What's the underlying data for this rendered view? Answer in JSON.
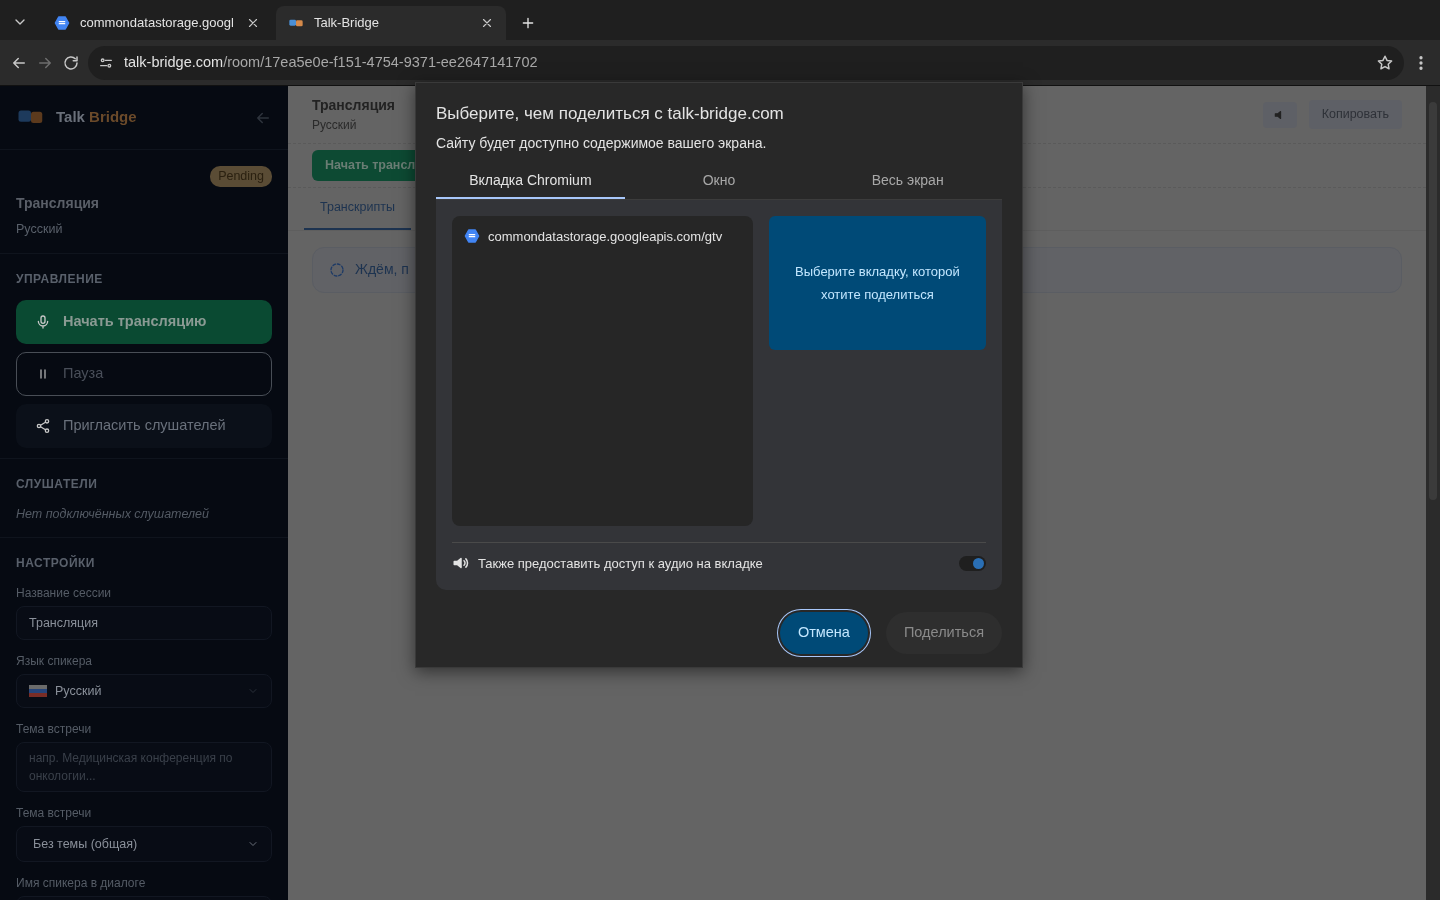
{
  "browser": {
    "tabs": [
      {
        "title": "commondatastorage.googl",
        "selected": false
      },
      {
        "title": "Talk-Bridge",
        "selected": true
      }
    ],
    "address": {
      "host": "talk-bridge.com",
      "path": "/room/17ea5e0e-f151-4754-9371-ee2647141702"
    }
  },
  "sidebar": {
    "brand": {
      "first": "Talk",
      "second": "Bridge"
    },
    "status_badge": "Pending",
    "session": {
      "title": "Трансляция",
      "language": "Русский"
    },
    "control_heading": "УПРАВЛЕНИЕ",
    "controls": [
      {
        "kind": "primary",
        "label": "Начать трансляцию",
        "disabled": false
      },
      {
        "kind": "outline",
        "label": "Пауза",
        "disabled": true
      },
      {
        "kind": "secondary",
        "label": "Пригласить слушателей",
        "disabled": false
      }
    ],
    "listeners_heading": "СЛУШАТЕЛИ",
    "listeners_empty": "Нет подключённых слушателей",
    "settings_heading": "НАСТРОЙКИ",
    "fields": [
      {
        "kind": "text",
        "label": "Название сессии",
        "value": "Трансляция"
      },
      {
        "kind": "flag-select",
        "label": "Язык спикера",
        "value": "Русский"
      },
      {
        "kind": "textarea",
        "label": "Тема встречи",
        "placeholder": "напр. Медицинская конференция по онкологии..."
      },
      {
        "kind": "select",
        "label": "Тема встречи",
        "value": "Без темы (общая)"
      },
      {
        "kind": "text",
        "label": "Имя спикера в диалоге"
      }
    ]
  },
  "main": {
    "title": "Трансляция",
    "subtitle": "Русский",
    "copy_button": "Копировать",
    "start_button": "Начать трансл",
    "tabs": [
      {
        "label": "Транскрипты",
        "selected": true
      }
    ],
    "waiting": "Ждём, п"
  },
  "dialog": {
    "title": "Выберите, чем поделиться с talk-bridge.com",
    "subtitle": "Сайту будет доступно содержимое вашего экрана.",
    "tabs": [
      {
        "label": "Вкладка Chromium",
        "selected": true
      },
      {
        "label": "Окно",
        "selected": false
      },
      {
        "label": "Весь экран",
        "selected": false
      }
    ],
    "items": [
      {
        "title": "commondatastorage.googleapis.com/gtv",
        "selected": false
      }
    ],
    "preview_hint": "Выберите вкладку, которой хотите поделиться",
    "audio": {
      "label": "Также предоставить доступ к аудио на вкладке",
      "on": true
    },
    "buttons": [
      {
        "kind": "primary",
        "label": "Отмена",
        "disabled": false
      },
      {
        "kind": "secondary",
        "label": "Поделиться",
        "disabled": true
      }
    ]
  }
}
